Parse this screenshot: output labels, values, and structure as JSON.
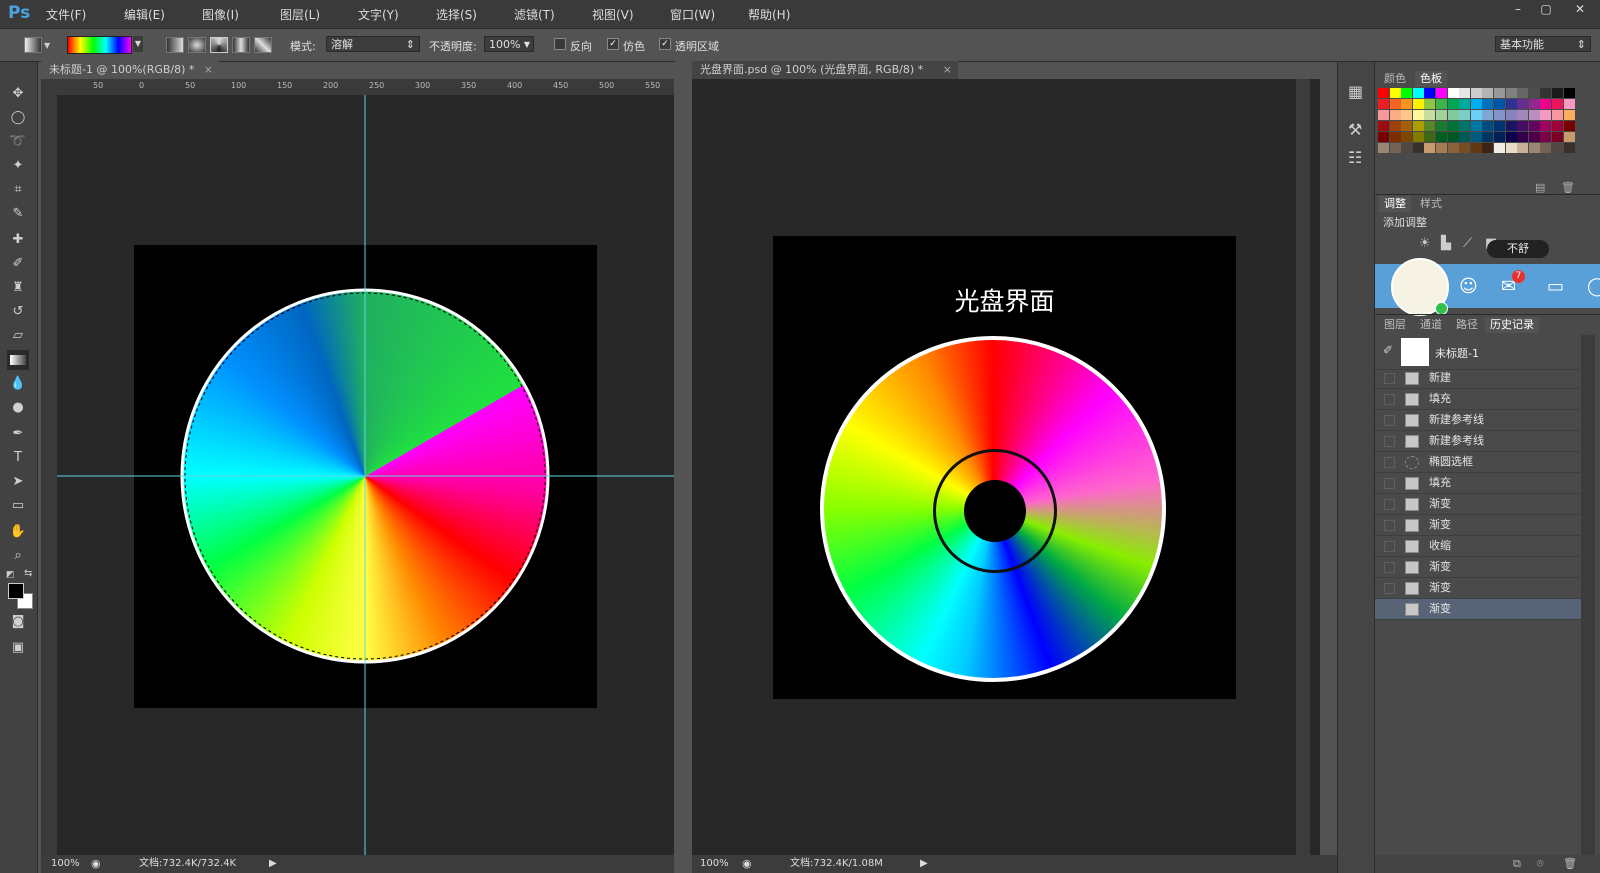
{
  "app": {
    "logo": "Ps"
  },
  "menu": [
    "文件(F)",
    "编辑(E)",
    "图像(I)",
    "图层(L)",
    "文字(Y)",
    "选择(S)",
    "滤镜(T)",
    "视图(V)",
    "窗口(W)",
    "帮助(H)"
  ],
  "window_controls": [
    "–",
    "▢",
    "✕"
  ],
  "options": {
    "mode_label": "模式:",
    "mode_value": "溶解",
    "opacity_label": "不透明度:",
    "opacity_value": "100%",
    "reverse_label": "反向",
    "dither_label": "仿色",
    "transparency_label": "透明区域",
    "workspace_value": "基本功能"
  },
  "doc1": {
    "tab_title": "未标题-1 @ 100%(RGB/8) *",
    "ruler_ticks": [
      "50",
      "0",
      "50",
      "100",
      "150",
      "200",
      "250",
      "300",
      "350",
      "400",
      "450",
      "500",
      "550"
    ],
    "zoom": "100%",
    "doc_size": "文档:732.4K/732.4K"
  },
  "doc2": {
    "tab_title": "光盘界面.psd @ 100% (光盘界面, RGB/8) *",
    "canvas_title": "光盘界面",
    "zoom": "100%",
    "doc_size": "文档:732.4K/1.08M"
  },
  "panels": {
    "color_tabs": [
      "颜色",
      "色板"
    ],
    "adjust_tabs": [
      "调整",
      "样式"
    ],
    "add_adjustment": "添加调整",
    "tooltip": "不舒",
    "badge_count": "7",
    "layer_tabs": [
      "图层",
      "通道",
      "路径",
      "历史记录"
    ],
    "history_snapshot": "未标题-1",
    "history": [
      {
        "label": "新建",
        "icon": "document-icon"
      },
      {
        "label": "填充",
        "icon": "fill-icon"
      },
      {
        "label": "新建参考线",
        "icon": "document-icon"
      },
      {
        "label": "新建参考线",
        "icon": "document-icon"
      },
      {
        "label": "椭圆选框",
        "icon": "ellipse-marquee-icon"
      },
      {
        "label": "填充",
        "icon": "fill-icon"
      },
      {
        "label": "渐变",
        "icon": "gradient-icon"
      },
      {
        "label": "渐变",
        "icon": "gradient-icon"
      },
      {
        "label": "收缩",
        "icon": "document-icon"
      },
      {
        "label": "渐变",
        "icon": "gradient-icon"
      },
      {
        "label": "渐变",
        "icon": "gradient-icon"
      },
      {
        "label": "渐变",
        "icon": "gradient-icon"
      }
    ]
  },
  "colors": {
    "accent_blue": "#4aa3df",
    "guide_cyan": "#5fd6e0",
    "history_selected": "#576478"
  }
}
